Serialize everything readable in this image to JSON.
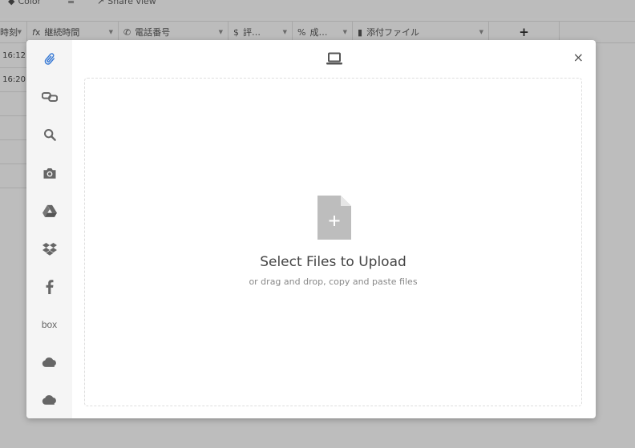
{
  "toolbar": {
    "color_label": "Color",
    "share_label": "Share view"
  },
  "header": {
    "col1": "時刻",
    "col2": "継続時間",
    "col3": "電話番号",
    "col4": "評…",
    "col5": "成…",
    "col6": "添付ファイル",
    "add": "+"
  },
  "rows": [
    "16:12",
    "16:20"
  ],
  "sidebar": {
    "items": [
      "attachment-icon",
      "link-icon",
      "search-icon",
      "camera-icon",
      "google-drive-icon",
      "dropbox-icon",
      "facebook-icon",
      "box",
      "onedrive-icon",
      "onedrive-business-icon"
    ],
    "box_label": "box"
  },
  "dropzone": {
    "title": "Select Files to Upload",
    "subtitle": "or drag and drop, copy and paste files"
  },
  "close_symbol": "×",
  "accent_color": "#3a7bd5"
}
